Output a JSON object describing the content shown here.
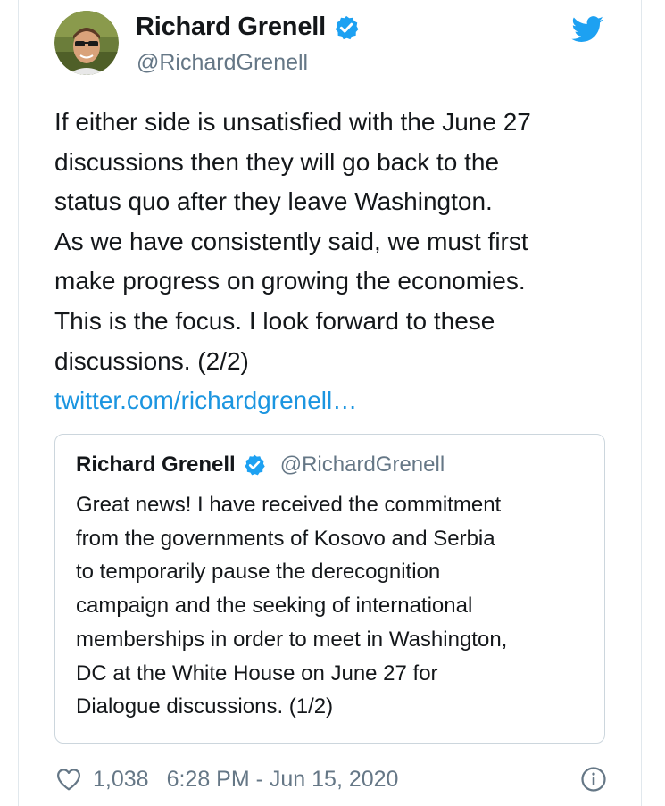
{
  "author": {
    "name": "Richard Grenell",
    "handle": "@RichardGrenell",
    "verified": true
  },
  "tweet": {
    "lines": [
      "If either side is unsatisfied with the June 27",
      "discussions then they will go back to the",
      "status quo after they leave Washington.",
      "As we have consistently said, we must first",
      "make progress on growing the economies.",
      "This is the focus. I look forward to these",
      "discussions. (2/2)"
    ],
    "link": "twitter.com/richardgrenell…"
  },
  "quoted_tweet": {
    "name": "Richard Grenell",
    "handle": "@RichardGrenell",
    "lines": [
      "Great news! I have received the commitment",
      "from the governments of Kosovo and Serbia",
      "to temporarily pause the derecognition",
      "campaign and the seeking of international",
      "memberships in order to meet in Washington,",
      "DC at the White House on June 27 for",
      "Dialogue discussions. (1/2)"
    ]
  },
  "footer": {
    "likes": "1,038",
    "timestamp": "6:28 PM - Jun 15, 2020"
  },
  "icons": {
    "verified": "verified-badge-icon",
    "twitter": "twitter-bird-icon",
    "like": "heart-icon",
    "info": "info-icon"
  },
  "colors": {
    "accent": "#1da1f2",
    "link": "#1b95e0",
    "text": "#14171a",
    "muted": "#657786",
    "border": "#ccd6dd"
  }
}
